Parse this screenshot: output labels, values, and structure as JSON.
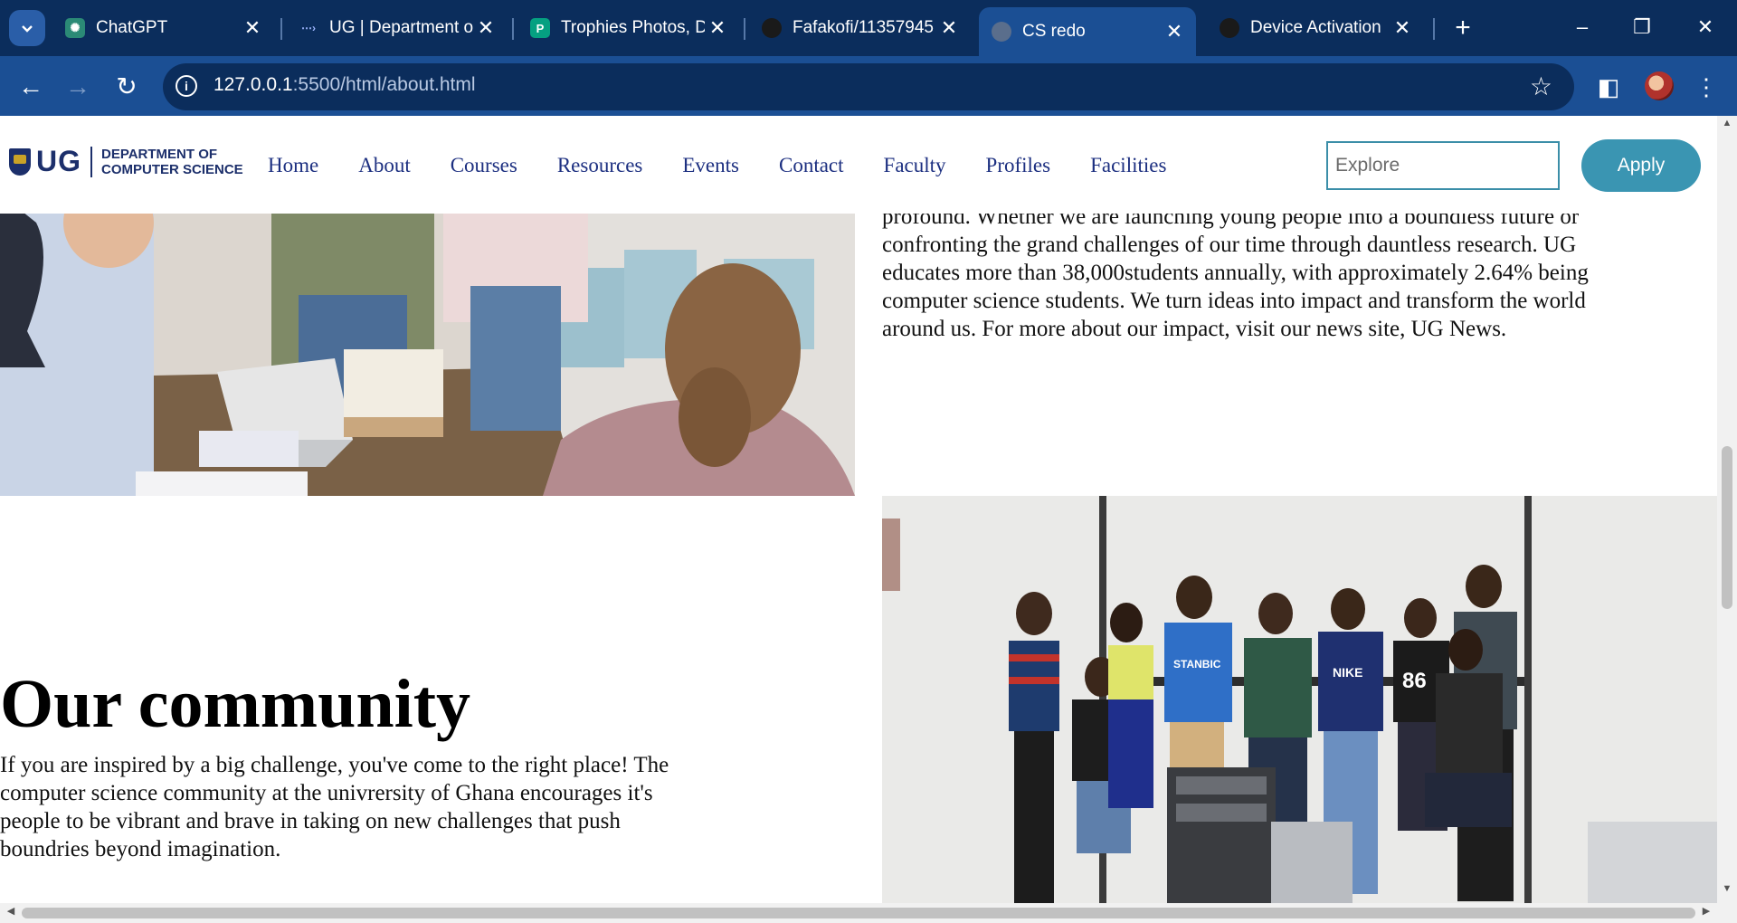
{
  "browser": {
    "tabs": [
      {
        "title": "ChatGPT",
        "icon": "chatgpt-icon",
        "active": false
      },
      {
        "title": "UG | Department o",
        "icon": "ug-favicon-icon",
        "active": false
      },
      {
        "title": "Trophies Photos, D",
        "icon": "pexels-icon",
        "active": false
      },
      {
        "title": "Fafakofi/11357945",
        "icon": "github-icon",
        "active": false
      },
      {
        "title": "CS redo",
        "icon": "globe-icon",
        "active": true
      },
      {
        "title": "Device Activation",
        "icon": "github-icon",
        "active": false
      }
    ],
    "url_host": "127.0.0.1",
    "url_path": ":5500/html/about.html"
  },
  "site": {
    "logo": {
      "ug": "UG",
      "dept_line1": "DEPARTMENT OF",
      "dept_line2": "COMPUTER SCIENCE"
    },
    "nav": [
      "Home",
      "About",
      "Courses",
      "Resources",
      "Events",
      "Contact",
      "Faculty",
      "Profiles",
      "Facilities"
    ],
    "search_placeholder": "Explore",
    "apply_label": "Apply"
  },
  "content": {
    "intro_partial": "profound. Whether we are launching young people into a boundless future or confronting the grand challenges of our time through dauntless research. UG educates more than 38,000students annually, with approximately 2.64% being computer science students. We turn ideas into impact and transform the world around us. For more about our impact, visit our news site, UG News.",
    "community_heading": "Our community",
    "community_text": "If you are inspired by a big challenge, you've come to the right place! The computer science community at the univrersity of Ghana encourages it's people to be vibrant and brave in taking on new challenges that push boundries beyond imagination.",
    "shirt_text": "STANBIC OPEN BANKING",
    "shirt_numbers": "86"
  },
  "colors": {
    "browser_dark": "#0b2d5c",
    "browser_blue": "#1b4f94",
    "nav_link": "#1c2f80",
    "apply_bg": "#3a95b2"
  }
}
